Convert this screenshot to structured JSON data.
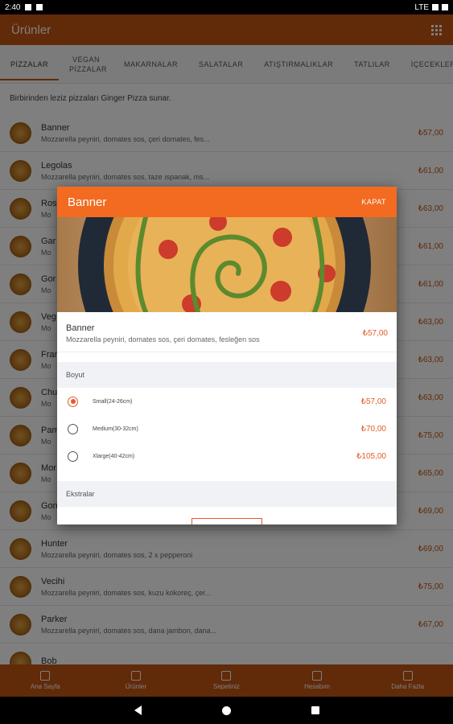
{
  "status": {
    "time": "2:40",
    "network": "LTE"
  },
  "appbar": {
    "title": "Ürünler"
  },
  "tabs": [
    {
      "label": "PİZZALAR"
    },
    {
      "label": "VEGAN PİZZALAR"
    },
    {
      "label": "MAKARNALAR"
    },
    {
      "label": "SALATALAR"
    },
    {
      "label": "ATIŞTIRMALIKLAR"
    },
    {
      "label": "TATLILAR"
    },
    {
      "label": "İÇECEKLER"
    }
  ],
  "intro": "Birbirinden leziz pizzaları Ginger Pizza sunar.",
  "products": [
    {
      "name": "Banner",
      "desc": "Mozzarella peyniri, domates sos, çeri domates, fes...",
      "price": "₺57,00"
    },
    {
      "name": "Legolas",
      "desc": "Mozzarella peyniri, domates sos, taze ıspanak, ms...",
      "price": "₺61,00"
    },
    {
      "name": "Ros",
      "desc": "Mo",
      "price": "₺63,00"
    },
    {
      "name": "Gar",
      "desc": "Mo",
      "price": "₺61,00"
    },
    {
      "name": "Gor",
      "desc": "Mo",
      "price": "₺61,00"
    },
    {
      "name": "Veg",
      "desc": "Mo",
      "price": "₺63,00"
    },
    {
      "name": "Fran",
      "desc": "Mo",
      "price": "₺63,00"
    },
    {
      "name": "Chu",
      "desc": "Mo",
      "price": "₺63,00"
    },
    {
      "name": "Pam",
      "desc": "Mo",
      "price": "₺75,00"
    },
    {
      "name": "Mor",
      "desc": "Mo",
      "price": "₺65,00"
    },
    {
      "name": "Gon",
      "desc": "Mo",
      "price": "₺69,00"
    },
    {
      "name": "Hunter",
      "desc": "Mozzarella peyniri, domates sos, 2 x pepperoni",
      "price": "₺69,00"
    },
    {
      "name": "Vecihi",
      "desc": "Mozzarella peyniri, domates sos, kuzu kokoreç, çer...",
      "price": "₺75,00"
    },
    {
      "name": "Parker",
      "desc": "Mozzarella peyniri, domates sos, dana jambon, dana...",
      "price": "₺67,00"
    },
    {
      "name": "Bob",
      "desc": "",
      "price": ""
    }
  ],
  "bottomnav": [
    {
      "label": "Ana Sayfa",
      "icon": "home-icon"
    },
    {
      "label": "Ürünler",
      "icon": "document-icon"
    },
    {
      "label": "Sepetiniz",
      "icon": "cart-icon"
    },
    {
      "label": "Hesabım",
      "icon": "person-icon"
    },
    {
      "label": "Daha Fazla",
      "icon": "grid-icon"
    }
  ],
  "dialog": {
    "title": "Banner",
    "close": "KAPAT",
    "product_name": "Banner",
    "product_desc": "Mozzarella peyniri, domates sos, çeri domates, fesleğen sos",
    "product_price": "₺57,00",
    "size_header": "Boyut",
    "sizes": [
      {
        "label": "Small(24-26cm)",
        "price": "₺57,00",
        "selected": true
      },
      {
        "label": "Medium(30-32cm)",
        "price": "₺70,00",
        "selected": false
      },
      {
        "label": "Xlarge(40-42cm)",
        "price": "₺105,00",
        "selected": false
      }
    ],
    "extras_header": "Ekstralar"
  },
  "colors": {
    "primary": "#c35412",
    "accent": "#f26b21",
    "price": "#e25b2a"
  }
}
